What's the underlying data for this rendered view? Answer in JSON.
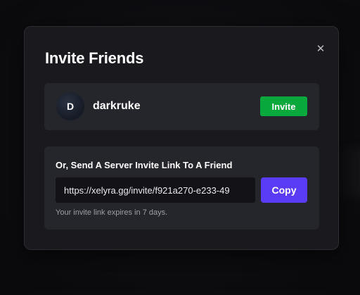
{
  "modal": {
    "title": "Invite Friends",
    "close_icon": "close-icon",
    "close_glyph": "✕"
  },
  "user": {
    "avatar_initial": "D",
    "username": "darkruke",
    "invite_label": "Invite"
  },
  "invite_link": {
    "heading": "Or, Send A Server Invite Link To A Friend",
    "url": "https://xelyra.gg/invite/f921a270-e233-49",
    "copy_label": "Copy",
    "expiry_note": "Your invite link expires in 7 days."
  },
  "colors": {
    "invite_button": "#09a83d",
    "copy_button": "#5b3cf6",
    "modal_background": "#19191e",
    "card_background": "#25252c"
  }
}
